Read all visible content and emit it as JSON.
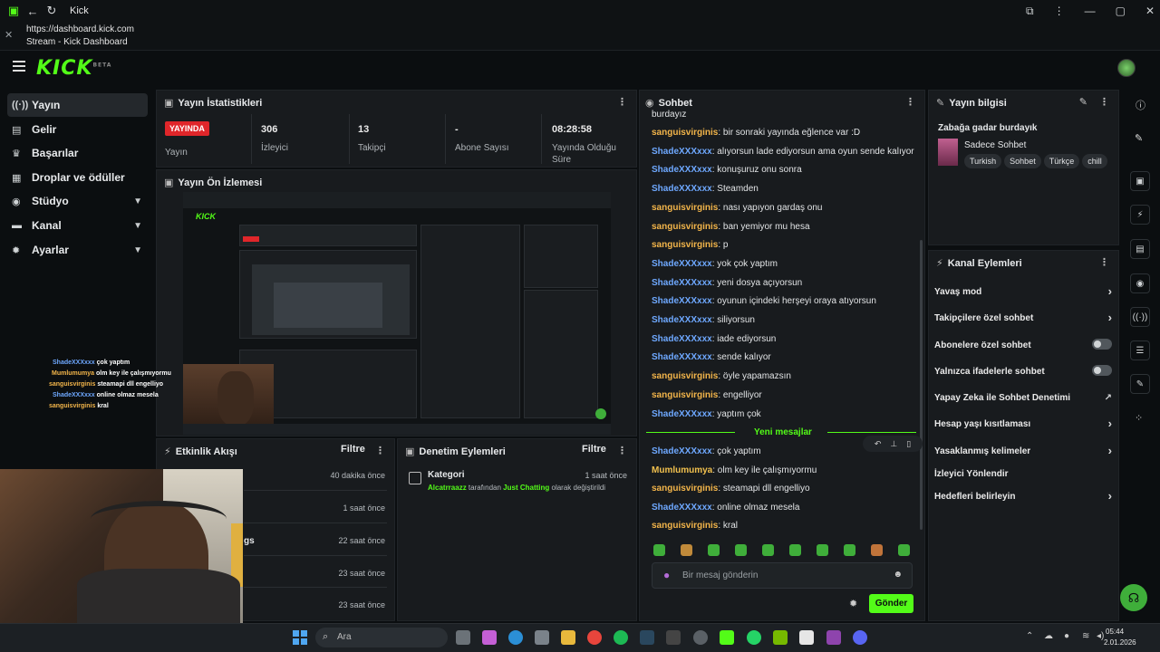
{
  "browser": {
    "title": "Kick",
    "url": "https://dashboard.kick.com",
    "tab_title": "Stream - Kick Dashboard"
  },
  "logo": {
    "text": "KICK",
    "badge": "BETA"
  },
  "sidebar": {
    "items": [
      {
        "label": "Yayın",
        "icon": "broadcast-icon"
      },
      {
        "label": "Gelir",
        "icon": "revenue-icon"
      },
      {
        "label": "Başarılar",
        "icon": "trophy-icon"
      },
      {
        "label": "Droplar ve ödüller",
        "icon": "gift-icon"
      },
      {
        "label": "Stüdyo",
        "icon": "studio-icon"
      },
      {
        "label": "Kanal",
        "icon": "channel-icon"
      },
      {
        "label": "Ayarlar",
        "icon": "gear-icon"
      }
    ]
  },
  "stats": {
    "title": "Yayın İstatistikleri",
    "live_badge": "YAYINDA",
    "items": [
      {
        "value": "",
        "label": "Yayın"
      },
      {
        "value": "306",
        "label": "İzleyici"
      },
      {
        "value": "13",
        "label": "Takipçi"
      },
      {
        "value": "-",
        "label": "Abone Sayısı"
      },
      {
        "value": "08:28:58",
        "label": "Yayında Olduğu Süre"
      }
    ]
  },
  "preview": {
    "title": "Yayın Ön İzlemesi"
  },
  "activity": {
    "title": "Etkinlik Akışı",
    "filter": "Filtre",
    "rows": [
      {
        "text": "",
        "time": "40 dakika önce"
      },
      {
        "text": "",
        "time": "1 saat önce"
      },
      {
        "text": "gs",
        "time": "22 saat önce"
      },
      {
        "text": "",
        "time": "23 saat önce"
      },
      {
        "text": "",
        "time": "23 saat önce"
      }
    ]
  },
  "moderation": {
    "title": "Denetim Eylemleri",
    "filter": "Filtre",
    "entry": {
      "category": "Kategori",
      "time": "1 saat önce",
      "user": "Alcatrraazz",
      "middle": " tarafından ",
      "game": "Just Chatting",
      "suffix": " olarak değiştirildi"
    }
  },
  "chat": {
    "title": "Sohbet",
    "top_line": "burdayız",
    "messages": [
      {
        "user": "sanguisvirginis",
        "text": ": bir sonraki yayında eğlence var :D",
        "color": "u2"
      },
      {
        "user": "ShadeXXXxxx",
        "text": ": alıyorsun lade ediyorsun ama oyun sende kalıyor",
        "color": "u1"
      },
      {
        "user": "ShadeXXXxxx",
        "text": ": konuşuruz onu sonra",
        "color": "u1"
      },
      {
        "user": "ShadeXXXxxx",
        "text": ": Steamden",
        "color": "u1"
      },
      {
        "user": "sanguisvirginis",
        "text": ": nası yapıyon gardaş onu",
        "color": "u2"
      },
      {
        "user": "sanguisvirginis",
        "text": ": ban yemiyor mu hesa",
        "color": "u2"
      },
      {
        "user": "sanguisvirginis",
        "text": ": p",
        "color": "u2"
      },
      {
        "user": "ShadeXXXxxx",
        "text": ": yok çok yaptım",
        "color": "u1"
      },
      {
        "user": "ShadeXXXxxx",
        "text": ": yeni dosya açıyorsun",
        "color": "u1"
      },
      {
        "user": "ShadeXXXxxx",
        "text": ": oyunun içindeki herşeyi oraya atıyorsun",
        "color": "u1"
      },
      {
        "user": "ShadeXXXxxx",
        "text": ": siliyorsun",
        "color": "u1"
      },
      {
        "user": "ShadeXXXxxx",
        "text": ": iade ediyorsun",
        "color": "u1"
      },
      {
        "user": "ShadeXXXxxx",
        "text": ": sende kalıyor",
        "color": "u1"
      },
      {
        "user": "sanguisvirginis",
        "text": ": öyle yapamazsın",
        "color": "u2"
      },
      {
        "user": "sanguisvirginis",
        "text": ": engelliyor",
        "color": "u2"
      },
      {
        "user": "ShadeXXXxxx",
        "text": ": yaptım çok",
        "color": "u1"
      }
    ],
    "new_messages_label": "Yeni mesajlar",
    "new_messages": [
      {
        "user": "ShadeXXXxxx",
        "text": ": çok yaptım",
        "color": "u1"
      },
      {
        "user": "Mumlumumya",
        "text": ": olm key ile çalışmıyormu",
        "color": "u3"
      },
      {
        "user": "sanguisvirginis",
        "text": ": steamapi dll engelliyo",
        "color": "u2"
      },
      {
        "user": "ShadeXXXxxx",
        "text": ": online olmaz mesela",
        "color": "u1"
      },
      {
        "user": "sanguisvirginis",
        "text": ": kral",
        "color": "u2"
      }
    ],
    "input_placeholder": "Bir mesaj gönderin",
    "send_label": "Gönder"
  },
  "stream_info": {
    "title": "Yayın bilgisi",
    "stream_title": "Zabağa gadar burdayık",
    "category": "Sadece Sohbet",
    "tags": [
      "Turkish",
      "Sohbet",
      "Türkçe",
      "chill"
    ]
  },
  "channel_actions": {
    "title": "Kanal Eylemleri",
    "rows": [
      {
        "label": "Yavaş mod",
        "kind": "chevron"
      },
      {
        "label": "Takipçilere özel sohbet",
        "kind": "chevron"
      },
      {
        "label": "Abonelere özel sohbet",
        "kind": "toggle"
      },
      {
        "label": "Yalnızca ifadelerle sohbet",
        "kind": "toggle"
      },
      {
        "label": "Yapay Zeka ile Sohbet Denetimi",
        "kind": "external"
      },
      {
        "label": "Hesap yaşı kısıtlaması",
        "kind": "chevron"
      },
      {
        "label": "Yasaklanmış kelimeler",
        "kind": "chevron"
      },
      {
        "label": "İzleyici Yönlendir",
        "kind": "none"
      },
      {
        "label": "Hedefleri belirleyin",
        "kind": "chevron"
      }
    ]
  },
  "overlay_chat": [
    {
      "user": "ShadeXXXxxx",
      "text": "çok yaptım",
      "color": "#6ea8ff"
    },
    {
      "user": "Mumlumumya",
      "text": "olm key ile çalışmıyormu",
      "color": "#f3b54a"
    },
    {
      "user": "sanguisvirginis",
      "text": "steamapi dll engelliyo",
      "color": "#f3b54a"
    },
    {
      "user": "ShadeXXXxxx",
      "text": "online olmaz mesela",
      "color": "#6ea8ff"
    },
    {
      "user": "sanguisvirginis",
      "text": "kral",
      "color": "#f3b54a"
    }
  ],
  "taskbar": {
    "search_placeholder": "Ara",
    "time": "05:44",
    "date": "2.01.2026"
  },
  "colors": {
    "accent": "#53fc18",
    "live": "#e0262a",
    "panel": "#181b1e"
  }
}
